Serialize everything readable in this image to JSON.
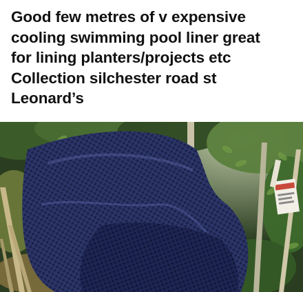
{
  "post": {
    "text": "Good few metres of v expensive\ncooling swimming pool liner great\nfor lining planters/projects etc\nCollection silchester road st\nLeonard’s"
  },
  "photo": {
    "icon": "photo-image",
    "colors": {
      "liner": "#2c3566",
      "foliage": "#3f6b2f",
      "background": "#23351c"
    }
  }
}
